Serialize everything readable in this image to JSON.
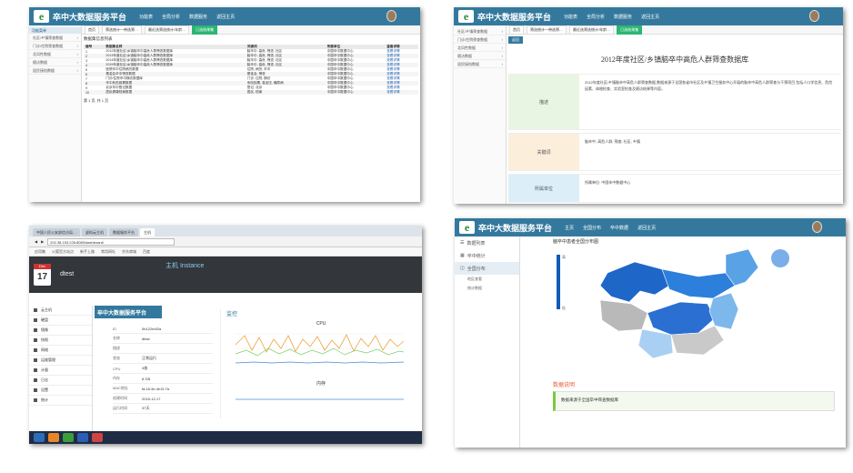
{
  "platform": {
    "logo": "e",
    "title": "卒中大数据服务平台"
  },
  "panel1": {
    "nav": [
      "功能表",
      "全局分析",
      "数据服务",
      "返回主页"
    ],
    "sidebar_header": "功能菜单",
    "sidebar": [
      "社区/乡镇筛查数据",
      "门诊/住院筛查数据",
      "北风性数据",
      "随访数据",
      "居民接档数据"
    ],
    "tabs": [
      "首页",
      "筛选统计一带选筛…",
      "最近选筛选统计/年龄…",
      "已选结果集"
    ],
    "list_title": "数据集信息列表",
    "columns": [
      "编号",
      "数据集名称",
      "关键词",
      "所属单位",
      "查看详情"
    ],
    "rows": [
      [
        "1",
        "2012年度社区/乡镇脑卒中高危人群筛查数据库",
        "脑卒中, 高危, 筛查, 社区",
        "中国卒中数据中心",
        "查看详情"
      ],
      [
        "2",
        "2013年度社区/乡镇脑卒中高危人群筛查数据库",
        "脑卒中, 高危, 筛查, 社区",
        "中国卒中数据中心",
        "查看详情"
      ],
      [
        "3",
        "2014年度社区/乡镇脑卒中高危人群筛查数据库",
        "脑卒中, 高危, 筛查, 社区",
        "中国卒中数据中心",
        "查看详情"
      ],
      [
        "4",
        "2015年度社区/乡镇脑卒中高危人群筛查数据库",
        "脑卒中, 高危, 筛查, 社区",
        "中国卒中数据中心",
        "查看详情"
      ],
      [
        "5",
        "医院卒中住院病历数据",
        "住院, 病历, 卒中",
        "中国卒中数据中心",
        "查看详情"
      ],
      [
        "6",
        "基金会卒中筛查数据",
        "基金会, 筛查",
        "中国卒中数据中心",
        "查看详情"
      ],
      [
        "7",
        "门诊/住院卒中随访数据库",
        "门诊, 住院, 随访",
        "中国卒中数据中心",
        "查看详情"
      ],
      [
        "8",
        "卒中危险因素数据",
        "危险因素, 高血压, 糖尿病",
        "中国卒中数据中心",
        "查看详情"
      ],
      [
        "9",
        "北京卒中登记数据",
        "登记, 北京",
        "中国卒中数据中心",
        "查看详情"
      ],
      [
        "10",
        "居民健康档案数据",
        "居民, 档案",
        "中国卒中数据中心",
        "查看详情"
      ]
    ],
    "pager": "第 1 页, 共 1 页"
  },
  "panel2": {
    "nav": [
      "功能表",
      "全局分析",
      "数据服务",
      "返回主页"
    ],
    "sidebar": [
      "社区/乡镇筛查数据",
      "门诊/住院筛查数据",
      "北风性数据",
      "随访数据",
      "居民接档数据"
    ],
    "tabs": [
      "首页",
      "筛选统计一带选筛…",
      "最近选筛选统计/年龄…",
      "已选结果集"
    ],
    "button": "返回",
    "report_title": "2012年度社区/乡镇脑卒中高危人群筛查数据库",
    "sections": [
      {
        "label": "描述",
        "body": "2012年度社区/乡镇脑卒中高危人群筛查数据,数据来源于全国各省市社区及乡镇卫生服务中心开展的脑卒中高危人群筛查与干预项目,包括人口学信息、危险因素、体格检查、实验室检查及随访结果等内容。"
      },
      {
        "label": "关键词",
        "body": "脑卒中; 高危人群; 筛查; 社区; 乡镇"
      },
      {
        "label": "所属单位",
        "body": "所属单位: 中国卒中数据中心"
      }
    ]
  },
  "panel3": {
    "tabs": [
      "中国人民公安部信访局…",
      "虚拟云主机",
      "数据服务平台",
      "主机"
    ],
    "address": "202.38.153.226:8080/dashboard/",
    "bookmarks": [
      "应用集",
      "火狐官方站点",
      "新手上路",
      "常用网址",
      "京东商城",
      "百度"
    ],
    "date_month": "Dec",
    "date_day": "17",
    "user": "dtest",
    "instance_title": "主机 Instance",
    "overlay_title": "卒中大数据服务平台",
    "menu": [
      "云主机",
      "硬盘",
      "镜像",
      "快照",
      "网络",
      "运维管理",
      "计量",
      "日志",
      "设置",
      "统计"
    ],
    "details": [
      [
        "ID",
        "0b122e4f2a"
      ],
      [
        "名称",
        "dtest"
      ],
      [
        "描述",
        ""
      ],
      [
        "状态",
        "正常运行"
      ],
      [
        "CPU",
        "4核"
      ],
      [
        "内存",
        "8 GB"
      ],
      [
        "MAC地址",
        "fa:16:3e:4e:f2:7a"
      ],
      [
        "创建时间",
        "2015-12-17"
      ],
      [
        "运行时间",
        "37天"
      ]
    ],
    "monitor": "监控",
    "cpu_label": "CPU",
    "mem_label": "内存"
  },
  "panel4": {
    "nav": [
      "主页",
      "全国分布",
      "卒中数据",
      "返回主页"
    ],
    "sidebar": [
      "数据列表",
      "卒中统计",
      "全国分布"
    ],
    "sub": [
      "地区查看",
      "统计数据"
    ],
    "map_title": "脑卒中患者全国分布图",
    "notes_title": "数据说明",
    "note": "数据来源于全国卒中筛查数据库",
    "legend": [
      "高",
      "低"
    ]
  }
}
